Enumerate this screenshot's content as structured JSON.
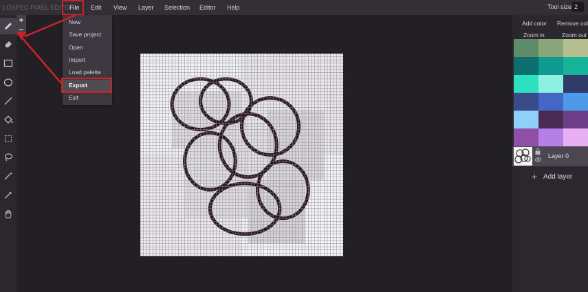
{
  "app": {
    "title": "LOSPEC PIXEL EDITOR"
  },
  "menu": {
    "items": [
      "File",
      "Edit",
      "View",
      "Layer",
      "Selection",
      "Editor",
      "Help"
    ]
  },
  "tool_size": {
    "label": "Tool size",
    "value": "2"
  },
  "size_buttons": {
    "plus": "+",
    "minus": "−"
  },
  "tools": [
    "pencil-icon",
    "eraser-icon",
    "rectangle-icon",
    "ellipse-icon",
    "line-icon",
    "fill-bucket-icon",
    "rectangular-selection-icon",
    "lasso-icon",
    "magic-wand-icon",
    "eyedropper-icon",
    "hand-pan-icon"
  ],
  "file_menu": {
    "items": [
      "New",
      "Save project",
      "Open",
      "Import",
      "Load palette",
      "Export",
      "Exit"
    ],
    "highlighted": "Export"
  },
  "right_panel": {
    "add_color": "Add color",
    "remove_color": "Remove colo",
    "zoom_in": "Zoom in",
    "zoom_out": "Zoom out"
  },
  "palette": {
    "colors": [
      "#5e8c6a",
      "#8aa67a",
      "#b5be8e",
      "#0d6d6f",
      "#0e9a8e",
      "#14b39a",
      "#2de0c0",
      "#8df0e0",
      "#2f3a66",
      "#3b4a8a",
      "#4466c4",
      "#4d9ae8",
      "#8fd0f8",
      "#4b2a55",
      "#6e3f88",
      "#9050a8",
      "#b480e8",
      "#e8b0f0"
    ]
  },
  "layers": [
    {
      "name": "Layer 0"
    }
  ],
  "add_layer": {
    "label": "Add layer"
  },
  "accent": {
    "annotation_red": "#d0202a",
    "outline": "#2a1820"
  }
}
